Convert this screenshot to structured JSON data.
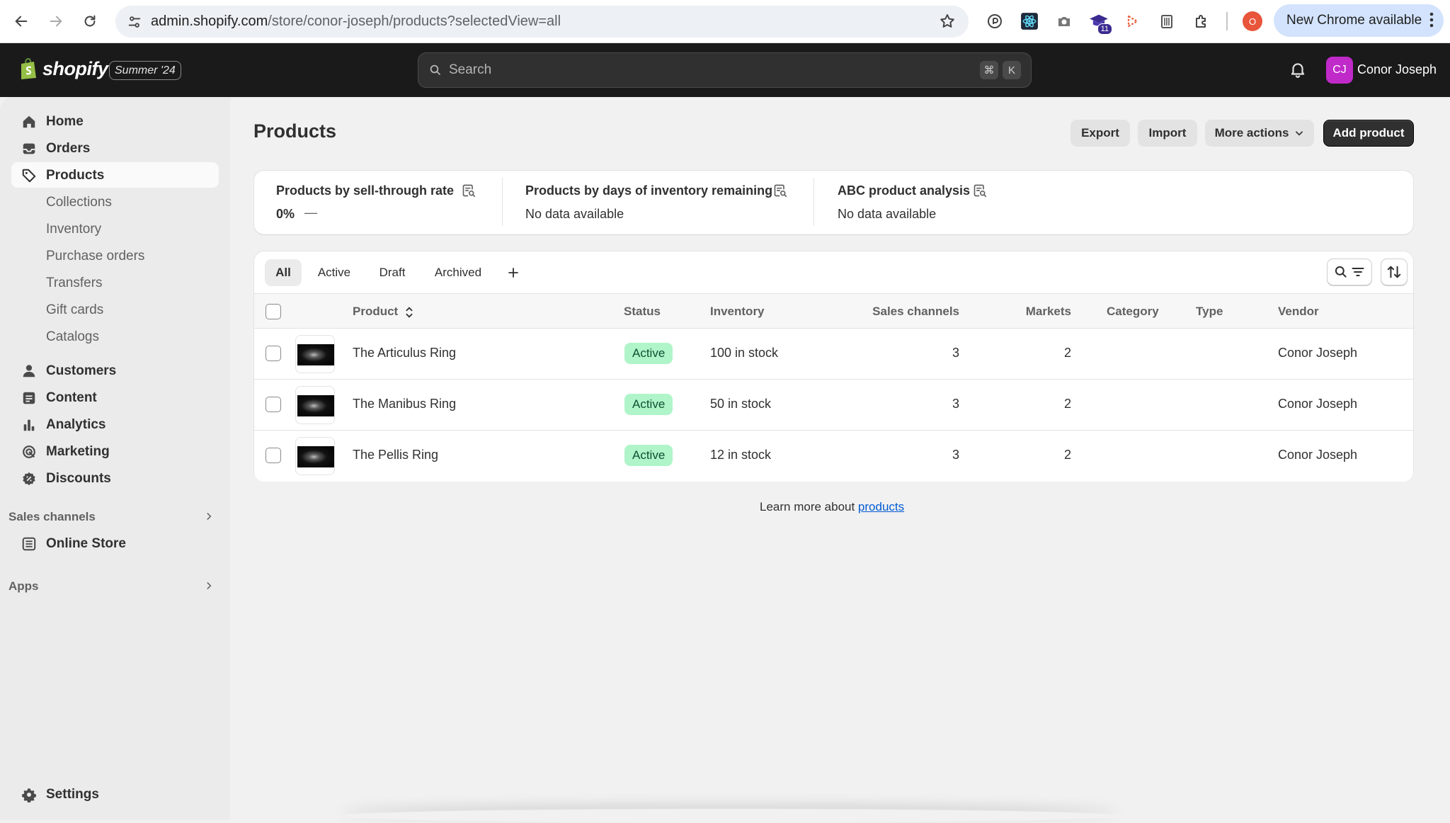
{
  "browser": {
    "url_host": "admin.shopify.com",
    "url_path": "/store/conor-joseph/products?selectedView=all",
    "new_chrome_label": "New Chrome available",
    "extension_badge": "11",
    "profile_initial": "O"
  },
  "topbar": {
    "brand": "shopify",
    "edition": "Summer '24",
    "search_placeholder": "Search",
    "kbd_cmd": "⌘",
    "kbd_k": "K",
    "avatar_initials": "CJ",
    "user_name": "Conor Joseph"
  },
  "sidebar": {
    "items": [
      {
        "label": "Home"
      },
      {
        "label": "Orders"
      },
      {
        "label": "Products"
      },
      {
        "label": "Customers"
      },
      {
        "label": "Content"
      },
      {
        "label": "Analytics"
      },
      {
        "label": "Marketing"
      },
      {
        "label": "Discounts"
      }
    ],
    "product_sub": [
      "Collections",
      "Inventory",
      "Purchase orders",
      "Transfers",
      "Gift cards",
      "Catalogs"
    ],
    "sales_channels_label": "Sales channels",
    "online_store_label": "Online Store",
    "apps_label": "Apps",
    "settings_label": "Settings"
  },
  "page": {
    "title": "Products",
    "export_label": "Export",
    "import_label": "Import",
    "more_actions_label": "More actions",
    "add_product_label": "Add product"
  },
  "metrics": [
    {
      "title": "Products by sell-through rate",
      "value": "0%",
      "trend": "—"
    },
    {
      "title": "Products by days of inventory remaining",
      "value": "No data available"
    },
    {
      "title": "ABC product analysis",
      "value": "No data available"
    }
  ],
  "tabs": [
    "All",
    "Active",
    "Draft",
    "Archived"
  ],
  "table": {
    "headers": {
      "product": "Product",
      "status": "Status",
      "inventory": "Inventory",
      "sales_channels": "Sales channels",
      "markets": "Markets",
      "category": "Category",
      "type": "Type",
      "vendor": "Vendor"
    },
    "rows": [
      {
        "name": "The Articulus Ring",
        "status": "Active",
        "inventory": "100 in stock",
        "sales_channels": "3",
        "markets": "2",
        "category": "",
        "type": "",
        "vendor": "Conor Joseph"
      },
      {
        "name": "The Manibus Ring",
        "status": "Active",
        "inventory": "50 in stock",
        "sales_channels": "3",
        "markets": "2",
        "category": "",
        "type": "",
        "vendor": "Conor Joseph"
      },
      {
        "name": "The Pellis Ring",
        "status": "Active",
        "inventory": "12 in stock",
        "sales_channels": "3",
        "markets": "2",
        "category": "",
        "type": "",
        "vendor": "Conor Joseph"
      }
    ]
  },
  "footer": {
    "learn_prefix": "Learn more about ",
    "learn_link": "products"
  },
  "colors": {
    "topbar": "#1a1a1a",
    "primary_button": "#303030",
    "active_badge_bg": "#aff5c9",
    "active_badge_text": "#0c5132",
    "link": "#005bd3",
    "avatar": "#c02ac9"
  }
}
